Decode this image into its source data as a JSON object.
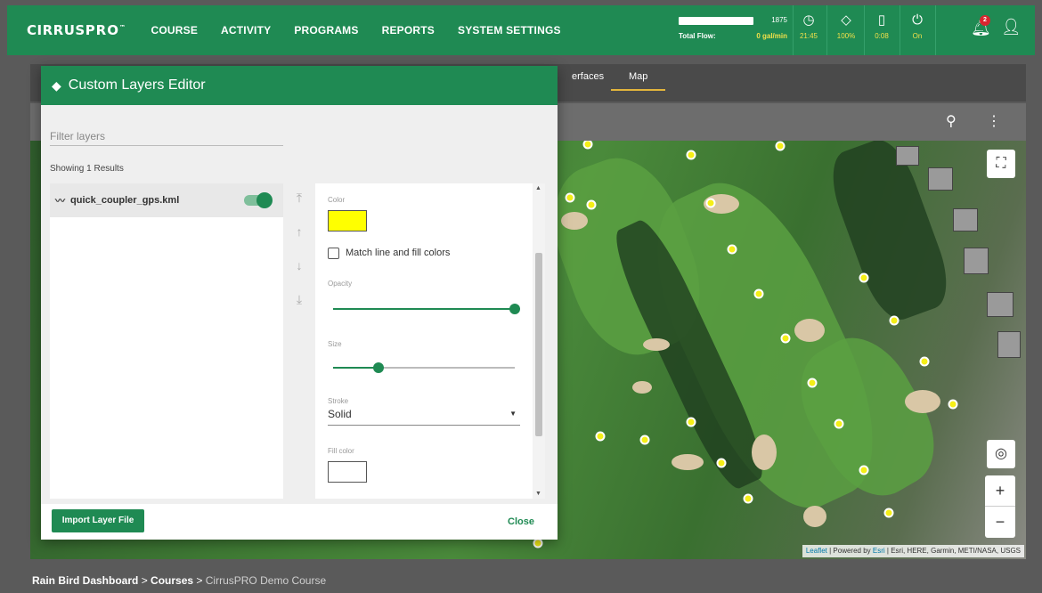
{
  "app": {
    "logo_main": "CIRRUS",
    "logo_accent": "PRO",
    "logo_tm": "™"
  },
  "nav": [
    "COURSE",
    "ACTIVITY",
    "PROGRAMS",
    "REPORTS",
    "SYSTEM SETTINGS"
  ],
  "flow": {
    "value": "1875",
    "label": "Total Flow:",
    "rate": "0 gal/min",
    "fill_fraction": 1.0
  },
  "stats": [
    {
      "icon": "clock-icon",
      "glyph": "◷",
      "value": "21:45"
    },
    {
      "icon": "water-drop-icon",
      "glyph": "◇",
      "value": "100%"
    },
    {
      "icon": "battery-icon",
      "glyph": "▯",
      "value": "0:08"
    },
    {
      "icon": "power-icon",
      "glyph": "⏻",
      "value": "On"
    }
  ],
  "notifications": {
    "count": "2"
  },
  "tabs": [
    {
      "label": "erfaces"
    },
    {
      "label": "Map",
      "active": true
    }
  ],
  "dialog": {
    "title": "Custom Layers Editor",
    "filter_placeholder": "Filter layers",
    "results_text": "Showing 1 Results",
    "layers": [
      {
        "name": "quick_coupler_gps.kml",
        "enabled": true
      }
    ],
    "props": {
      "color_label": "Color",
      "color_value": "#ffff00",
      "match_label": "Match line and fill colors",
      "opacity_label": "Opacity",
      "opacity_value": 1.0,
      "size_label": "Size",
      "size_value": 0.25,
      "stroke_label": "Stroke",
      "stroke_value": "Solid",
      "fill_label": "Fill color",
      "fill_value": "#ffffff"
    },
    "import_label": "Import Layer File",
    "close_label": "Close"
  },
  "map": {
    "attribution_leaflet": "Leaflet",
    "attribution_mid": " | Powered by ",
    "attribution_esri": "Esri",
    "attribution_rest": " | Esri, HERE, Garmin, METI/NASA, USGS"
  },
  "breadcrumb": {
    "part1": "Rain Bird Dashboard",
    "sep": " > ",
    "part2": "Courses",
    "current": "CirrusPRO Demo Course"
  },
  "colors": {
    "brand": "#1f8a53",
    "accent_yellow": "#f1e04a",
    "badge": "#d8262f"
  }
}
